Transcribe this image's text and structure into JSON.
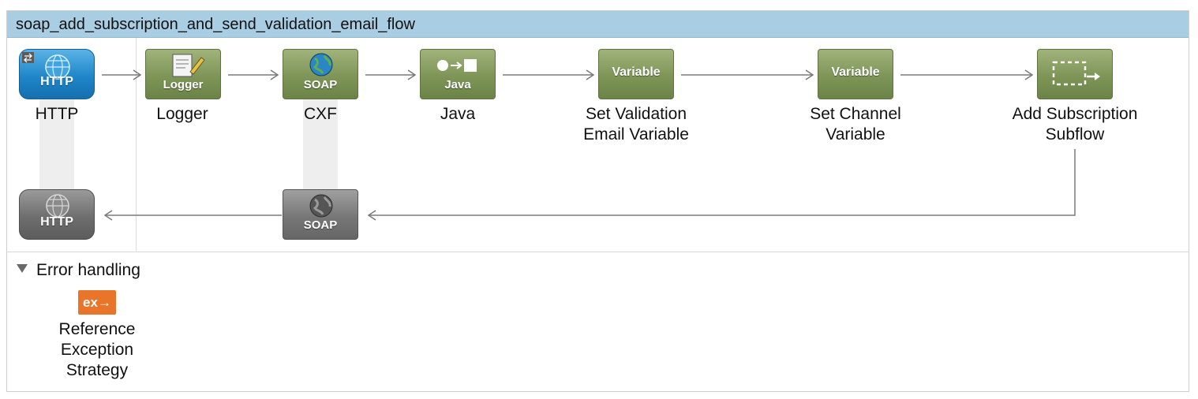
{
  "flow": {
    "title": "soap_add_subscription_and_send_validation_email_flow"
  },
  "nodes": [
    {
      "id": "http",
      "label": "HTTP",
      "tile_text": "HTTP",
      "icon": "globe-icon"
    },
    {
      "id": "logger",
      "label": "Logger",
      "tile_text": "Logger",
      "icon": "notepad-pencil-icon"
    },
    {
      "id": "cxf",
      "label": "CXF",
      "tile_text": "SOAP",
      "icon": "globe-icon"
    },
    {
      "id": "java",
      "label": "Java",
      "tile_text": "Java",
      "icon": "circle-arrow-square-icon"
    },
    {
      "id": "set-validation",
      "label_line1": "Set Validation",
      "label_line2": "Email Variable",
      "tile_text": "Variable"
    },
    {
      "id": "set-channel",
      "label_line1": "Set Channel",
      "label_line2": "Variable",
      "tile_text": "Variable"
    },
    {
      "id": "add-subscription",
      "label_line1": "Add Subscription",
      "label_line2": "Subflow",
      "icon": "dashed-box-arrow-icon"
    }
  ],
  "return_nodes": [
    {
      "id": "http-response",
      "tile_text": "HTTP",
      "icon": "globe-icon"
    },
    {
      "id": "cxf-response",
      "tile_text": "SOAP",
      "icon": "globe-icon"
    }
  ],
  "error_handling": {
    "title": "Error handling",
    "icon_text": "ex→",
    "strategy_line1": "Reference",
    "strategy_line2": "Exception",
    "strategy_line3": "Strategy"
  },
  "colors": {
    "header": "#a9cde2",
    "processor_green": "#7e9557",
    "http_blue": "#1f86c9",
    "response_gray": "#6e6e6e",
    "exception_orange": "#e9752a"
  }
}
